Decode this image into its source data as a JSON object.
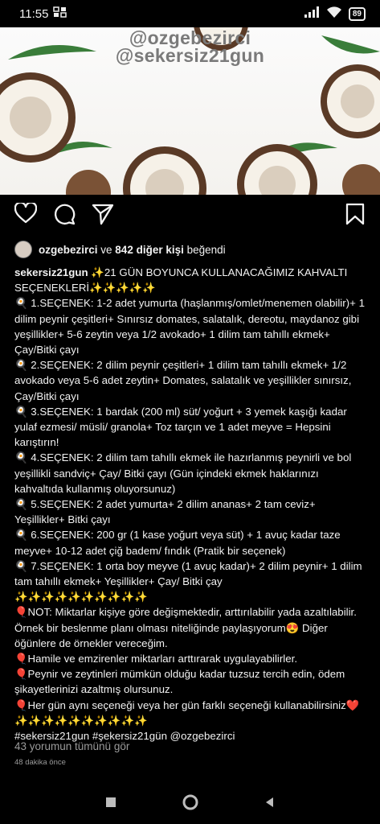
{
  "status_bar": {
    "time": "11:55",
    "battery": "89"
  },
  "post_image": {
    "watermark_1": "@ozgebezirci",
    "watermark_2": "@sekersiz21gun"
  },
  "likes": {
    "user": "ozgebezirci",
    "connector": " ve ",
    "count_text": "842 diğer kişi",
    "suffix": " beğendi"
  },
  "caption": {
    "username": "sekersiz21gun",
    "text": " ✨21 GÜN BOYUNCA KULLANACAĞIMIZ KAHVALTI SEÇENEKLERİ✨✨✨✨✨\n🍳 1.SEÇENEK: 1-2 adet yumurta (haşlanmış/omlet/menemen olabilir)+ 1 dilim peynir çeşitleri+ Sınırsız domates, salatalık, dereotu, maydanoz gibi yeşillikler+ 5-6 zeytin veya 1/2 avokado+ 1 dilim tam tahıllı ekmek+ Çay/Bitki çayı\n🍳 2.SEÇENEK: 2 dilim peynir çeşitleri+ 1 dilim tam tahıllı ekmek+ 1/2 avokado veya 5-6 adet zeytin+ Domates, salatalık ve yeşillikler sınırsız, Çay/Bitki çayı\n🍳 3.SEÇENEK: 1 bardak (200 ml) süt/ yoğurt + 3 yemek kaşığı kadar yulaf ezmesi/ müsli/ granola+ Toz tarçın ve 1 adet meyve = Hepsini karıştırın!\n🍳 4.SEÇENEK: 2 dilim tam tahıllı ekmek ile hazırlanmış peynirli ve bol yeşillikli sandviç+ Çay/ Bitki çayı (Gün içindeki ekmek haklarınızı kahvaltıda kullanmış oluyorsunuz)\n🍳 5.SEÇENEK: 2 adet yumurta+ 2 dilim ananas+ 2 tam ceviz+ Yeşillikler+ Bitki çayı\n🍳 6.SEÇENEK: 200 gr (1 kase yoğurt veya süt) + 1 avuç kadar taze meyve+ 10-12 adet çiğ badem/ fındık (Pratik bir seçenek)\n🍳 7.SEÇENEK: 1 orta boy meyve (1 avuç kadar)+ 2 dilim peynir+ 1 dilim tam tahıllı ekmek+ Yeşillikler+ Çay/ Bitki çay\n✨✨✨✨✨✨✨✨✨✨\n🎈NOT: Miktarlar kişiye göre değişmektedir, arttırılabilir yada azaltılabilir. Örnek bir beslenme planı olması niteliğinde paylaşıyorum😍 Diğer öğünlere de örnekler vereceğim.\n🎈Hamile ve emzirenler miktarları arttırarak uygulayabilirler.\n🎈Peynir ve zeytinleri mümkün olduğu kadar tuzsuz tercih edin, ödem şikayetlerinizi azaltmış olursunuz.\n🎈Her gün aynı seçeneği veya her gün farklı seçeneği kullanabilirsiniz❤️\n✨✨✨✨✨✨✨✨✨✨\n#sekersiz21gun #şekersiz21gün @ozgebezirci"
  },
  "comments_link": "43 yorumun tümünü gör",
  "timestamp": "48 dakika önce",
  "icons": {
    "like": "heart-icon",
    "comment": "comment-icon",
    "share": "paper-plane-icon",
    "save": "bookmark-icon",
    "nav_back": "back-triangle-icon",
    "nav_home": "home-circle-icon",
    "nav_recents": "recents-square-icon"
  }
}
